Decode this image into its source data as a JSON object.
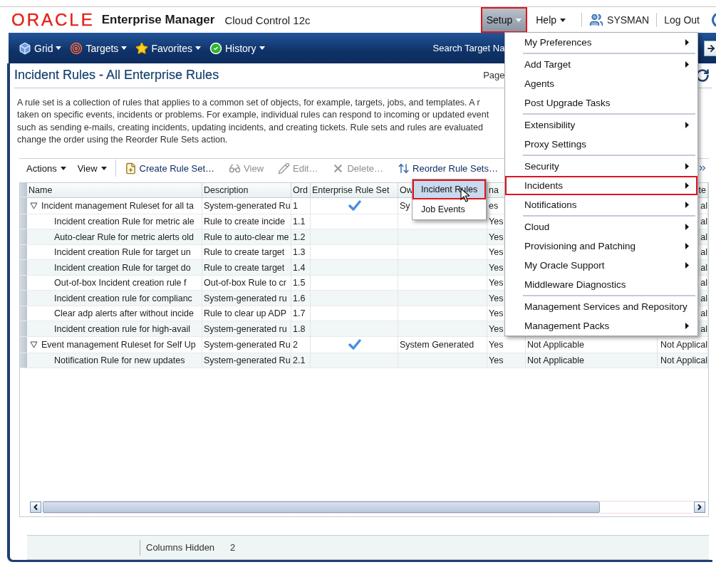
{
  "header": {
    "logo": "ORACLE",
    "product": "Enterprise Manager",
    "edition": "Cloud Control 12c",
    "menus": [
      {
        "label": "Setup",
        "selected": true,
        "highlighted": true
      },
      {
        "label": "Help",
        "selected": false,
        "highlighted": false
      }
    ],
    "user": "SYSMAN",
    "logout": "Log Out"
  },
  "nav": {
    "items": [
      {
        "label": "Grid",
        "kind": "cube"
      },
      {
        "label": "Targets",
        "kind": "target"
      },
      {
        "label": "Favorites",
        "kind": "star"
      },
      {
        "label": "History",
        "kind": "check"
      }
    ],
    "search_label": "Search Target Na"
  },
  "page": {
    "title": "Incident Rules - All Enterprise Rules",
    "pagination_label": "Page",
    "description_lines": [
      "A rule set is a collection of rules that applies to a common set of objects, for example, targets, jobs, and templates. A r",
      "taken on specific events, incidents or problems. For example, individual rules can respond to incoming or updated event",
      "such as sending e-mails, creating incidents, updating incidents, and creating tickets. Rule sets and rules are evaluated",
      "change the order using the Reorder Rule Sets action."
    ]
  },
  "toolbar": {
    "menus": [
      "Actions",
      "View"
    ],
    "buttons": [
      {
        "label": "Create Rule Set…",
        "kind": "create",
        "disabled": false
      },
      {
        "label": "View",
        "kind": "glasses",
        "disabled": true
      },
      {
        "label": "Edit…",
        "kind": "pencil",
        "disabled": true
      },
      {
        "label": "Delete…",
        "kind": "delete",
        "disabled": true
      },
      {
        "label": "Reorder Rule Sets…",
        "kind": "reorder",
        "disabled": false
      }
    ]
  },
  "table": {
    "columns": [
      {
        "label": "Name"
      },
      {
        "label": "Description"
      },
      {
        "label": "Ord"
      },
      {
        "label": "Enterprise Rule Set"
      },
      {
        "label": "Ow"
      },
      {
        "label": "na"
      },
      {},
      {
        "label": "te"
      }
    ],
    "rows": [
      {
        "name": "Incident management Ruleset for all ta",
        "description": "System-generated Ru",
        "order": "1",
        "enterprise_rule_set": true,
        "owner": "Sy",
        "enabled": "es",
        "column_8": "al",
        "expanded": true,
        "children": [
          {
            "name": "Incident creation Rule for metric ale",
            "description": "Rule to create incide",
            "order": "1.1",
            "enabled": "Yes",
            "column_8": "al"
          },
          {
            "name": "Auto-clear Rule for metric alerts old",
            "description": "Rule to auto-clear me",
            "order": "1.2",
            "enabled": "Yes",
            "column_8": "al"
          },
          {
            "name": "Incident creation Rule for target un",
            "description": "Rule to create target",
            "order": "1.3",
            "enabled": "Yes",
            "column_8": "al"
          },
          {
            "name": "Incident creation Rule for target do",
            "description": "Rule to create target",
            "order": "1.4",
            "enabled": "Yes",
            "column_8": "al"
          },
          {
            "name": "Out-of-box Incident creation rule f",
            "description": "Out-of-box Rule to cr",
            "order": "1.5",
            "enabled": "Yes",
            "column_8": "al"
          },
          {
            "name": "Incident creation rule for complianc",
            "description": "System-generated ru",
            "order": "1.6",
            "enabled": "Yes",
            "column_8": "al"
          },
          {
            "name": "Clear adp alerts after without incide",
            "description": "Rule to clear up ADP",
            "order": "1.7",
            "enabled": "Yes",
            "column_8": "al"
          },
          {
            "name": "Incident creation rule for high-avail",
            "description": "System-generated ru",
            "order": "1.8",
            "enabled": "Yes",
            "column_8": "al"
          }
        ]
      },
      {
        "name": "Event management Ruleset for Self Up",
        "description": "System-generated Ru",
        "order": "2",
        "enterprise_rule_set": true,
        "owner": "System Generated",
        "enabled": "Yes",
        "column_7": "Not Applicable",
        "column_8": "Not Applical",
        "expanded": true,
        "children": [
          {
            "name": "Notification Rule for new updates",
            "description": "System-generated Ru",
            "order": "2.1",
            "enabled": "Yes",
            "column_7": "Not Applicable",
            "column_8": "Not Applical"
          }
        ]
      }
    ]
  },
  "status_bar": {
    "label": "Columns Hidden",
    "value": "2"
  },
  "setup_menu": {
    "groups": [
      [
        {
          "label": "My Preferences",
          "submenu": true,
          "highlighted": false
        }
      ],
      [
        {
          "label": "Add Target",
          "submenu": true,
          "highlighted": false
        },
        {
          "label": "Agents",
          "submenu": false,
          "highlighted": false
        },
        {
          "label": "Post Upgrade Tasks",
          "submenu": false,
          "highlighted": false
        }
      ],
      [
        {
          "label": "Extensibility",
          "submenu": true,
          "highlighted": false
        },
        {
          "label": "Proxy Settings",
          "submenu": false,
          "highlighted": false
        }
      ],
      [
        {
          "label": "Security",
          "submenu": true,
          "highlighted": false
        },
        {
          "label": "Incidents",
          "submenu": true,
          "highlighted": true
        },
        {
          "label": "Notifications",
          "submenu": true,
          "highlighted": false
        }
      ],
      [
        {
          "label": "Cloud",
          "submenu": true,
          "highlighted": false
        },
        {
          "label": "Provisioning and Patching",
          "submenu": true,
          "highlighted": false
        },
        {
          "label": "My Oracle Support",
          "submenu": true,
          "highlighted": false
        },
        {
          "label": "Middleware Diagnostics",
          "submenu": false,
          "highlighted": false
        }
      ],
      [
        {
          "label": "Management Services and Repository",
          "submenu": false,
          "highlighted": false
        },
        {
          "label": "Management Packs",
          "submenu": true,
          "highlighted": false
        }
      ]
    ]
  },
  "incidents_submenu": {
    "items": [
      {
        "label": "Incident Rules",
        "selected": true,
        "highlighted": true
      },
      {
        "label": "Job Events",
        "selected": false,
        "highlighted": false
      }
    ]
  }
}
